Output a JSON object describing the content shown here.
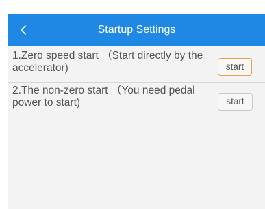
{
  "header": {
    "title": "Startup Settings",
    "back_icon": "chevron-left-icon"
  },
  "options": [
    {
      "label": "1.Zero speed start （Start directly by the accelerator)",
      "button_label": "start",
      "button_state": "highlighted"
    },
    {
      "label": "2.The non-zero start （You need pedal power to start)",
      "button_label": "start",
      "button_state": "normal"
    }
  ],
  "colors": {
    "header_bg": "#1f88e5",
    "screen_bg": "#f3f3f3",
    "highlight_border": "#e4a24a",
    "normal_border": "#c8c8c8",
    "text": "#555555"
  }
}
